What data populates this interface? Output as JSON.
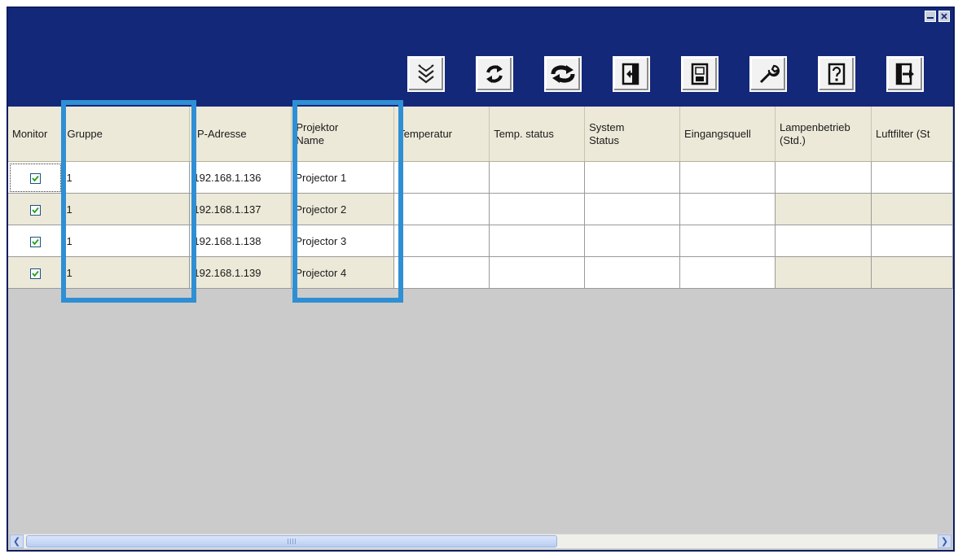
{
  "toolbar": {
    "buttons": [
      {
        "icon": "expand-down-icon"
      },
      {
        "icon": "refresh-icon"
      },
      {
        "icon": "sync-icon"
      },
      {
        "icon": "import-icon"
      },
      {
        "icon": "save-icon"
      },
      {
        "icon": "wrench-icon"
      },
      {
        "icon": "help-icon"
      },
      {
        "icon": "exit-icon"
      }
    ]
  },
  "table": {
    "columns": [
      "Monitor",
      "Gruppe",
      "IP-Adresse",
      "Projektor\nName",
      "Temperatur",
      "Temp. status",
      "System\nStatus",
      "Eingangsquell",
      "Lampenbetrieb\n(Std.)",
      "Luftfilter (St"
    ],
    "rows": [
      {
        "monitor": true,
        "group": "1",
        "ip": "192.168.1.136",
        "name": "Projector 1"
      },
      {
        "monitor": true,
        "group": "1",
        "ip": "192.168.1.137",
        "name": "Projector 2"
      },
      {
        "monitor": true,
        "group": "1",
        "ip": "192.168.1.138",
        "name": "Projector 3"
      },
      {
        "monitor": true,
        "group": "1",
        "ip": "192.168.1.139",
        "name": "Projector 4"
      }
    ]
  },
  "colors": {
    "toolbar_bg": "#14287a",
    "highlight": "#2f8fd4",
    "header_bg": "#ece9d8",
    "empty_area": "#cbcbcb"
  }
}
